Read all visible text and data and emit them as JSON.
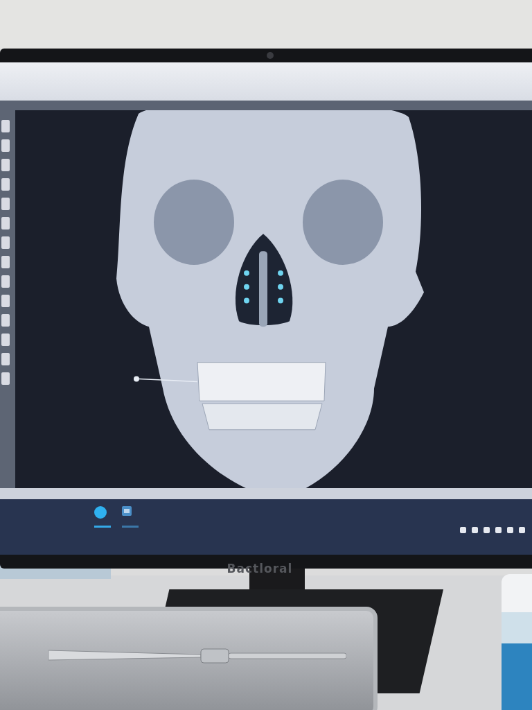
{
  "monitor": {
    "logo": "Bactloral"
  },
  "taskbar": {
    "apps": [
      {
        "kind": "circle",
        "selected": true
      },
      {
        "kind": "window",
        "selected": false
      }
    ]
  }
}
